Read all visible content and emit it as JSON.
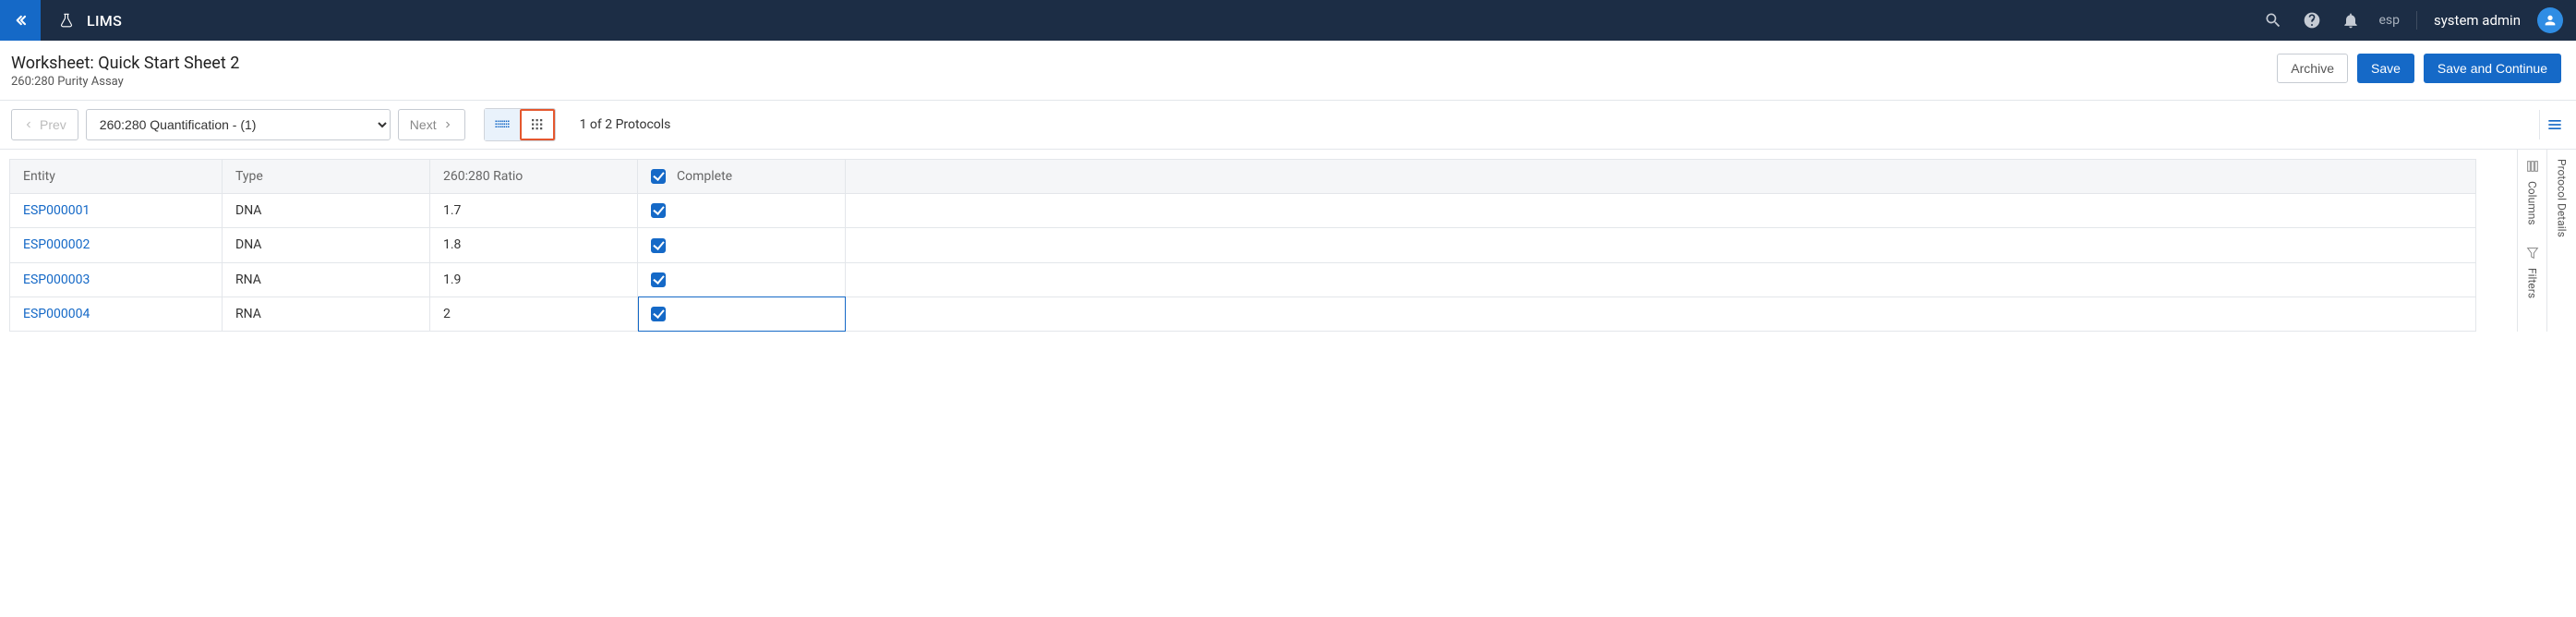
{
  "app": {
    "name": "LIMS"
  },
  "user": {
    "env": "esp",
    "name": "system admin"
  },
  "page": {
    "title": "Worksheet: Quick Start Sheet 2",
    "subtitle": "260:280 Purity Assay"
  },
  "actions": {
    "archive": "Archive",
    "save": "Save",
    "save_continue": "Save and Continue"
  },
  "toolbar": {
    "prev": "Prev",
    "next": "Next",
    "protocol_select": "260:280 Quantification - (1)",
    "count_text": "1 of 2 Protocols"
  },
  "rails": {
    "columns": "Columns",
    "filters": "Filters",
    "protocol_details": "Protocol Details"
  },
  "table": {
    "headers": {
      "entity": "Entity",
      "type": "Type",
      "ratio": "260:280 Ratio",
      "complete": "Complete"
    },
    "rows": [
      {
        "entity": "ESP000001",
        "type": "DNA",
        "ratio": "1.7",
        "complete": true,
        "selected": false
      },
      {
        "entity": "ESP000002",
        "type": "DNA",
        "ratio": "1.8",
        "complete": true,
        "selected": false
      },
      {
        "entity": "ESP000003",
        "type": "RNA",
        "ratio": "1.9",
        "complete": true,
        "selected": false
      },
      {
        "entity": "ESP000004",
        "type": "RNA",
        "ratio": "2",
        "complete": true,
        "selected": true
      }
    ]
  }
}
